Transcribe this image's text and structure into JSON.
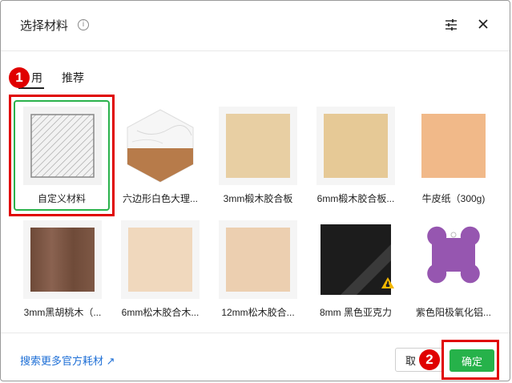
{
  "dialog": {
    "title": "选择材料",
    "info_icon": "info-icon",
    "tune_icon": "sliders-icon",
    "close_icon": "close-icon"
  },
  "tabs": [
    {
      "label": "常用",
      "visible_label": "用",
      "selected": true
    },
    {
      "label": "推荐",
      "selected": false
    }
  ],
  "materials": [
    {
      "label": "自定义材料",
      "selected": true,
      "swatch": "custom-hatch"
    },
    {
      "label": "六边形白色大理...",
      "swatch": "hexagon-marble"
    },
    {
      "label": "3mm椴木胶合板",
      "swatch": "#e8cfa3"
    },
    {
      "label": "6mm椴木胶合板...",
      "swatch": "#e6c996"
    },
    {
      "label": "牛皮纸（300g)",
      "swatch": "#f1b989"
    },
    {
      "label": "3mm黑胡桃木（...",
      "swatch": "#7a5441"
    },
    {
      "label": "6mm松木胶合木...",
      "swatch": "#f0d8bd"
    },
    {
      "label": "12mm松木胶合...",
      "swatch": "#eccfb0"
    },
    {
      "label": "8mm 黑色亚克力",
      "swatch": "#1c1c1c"
    },
    {
      "label": "紫色阳极氧化铝...",
      "swatch": "#9656b0"
    }
  ],
  "annotations": [
    {
      "number": "1"
    },
    {
      "number": "2"
    }
  ],
  "footer": {
    "link_text": "搜索更多官方耗材 ↗",
    "cancel_label": "取",
    "ok_label": "确定"
  },
  "colors": {
    "accent_green": "#26b24a",
    "link_blue": "#1e6fd6",
    "annotation_red": "#e00000"
  }
}
